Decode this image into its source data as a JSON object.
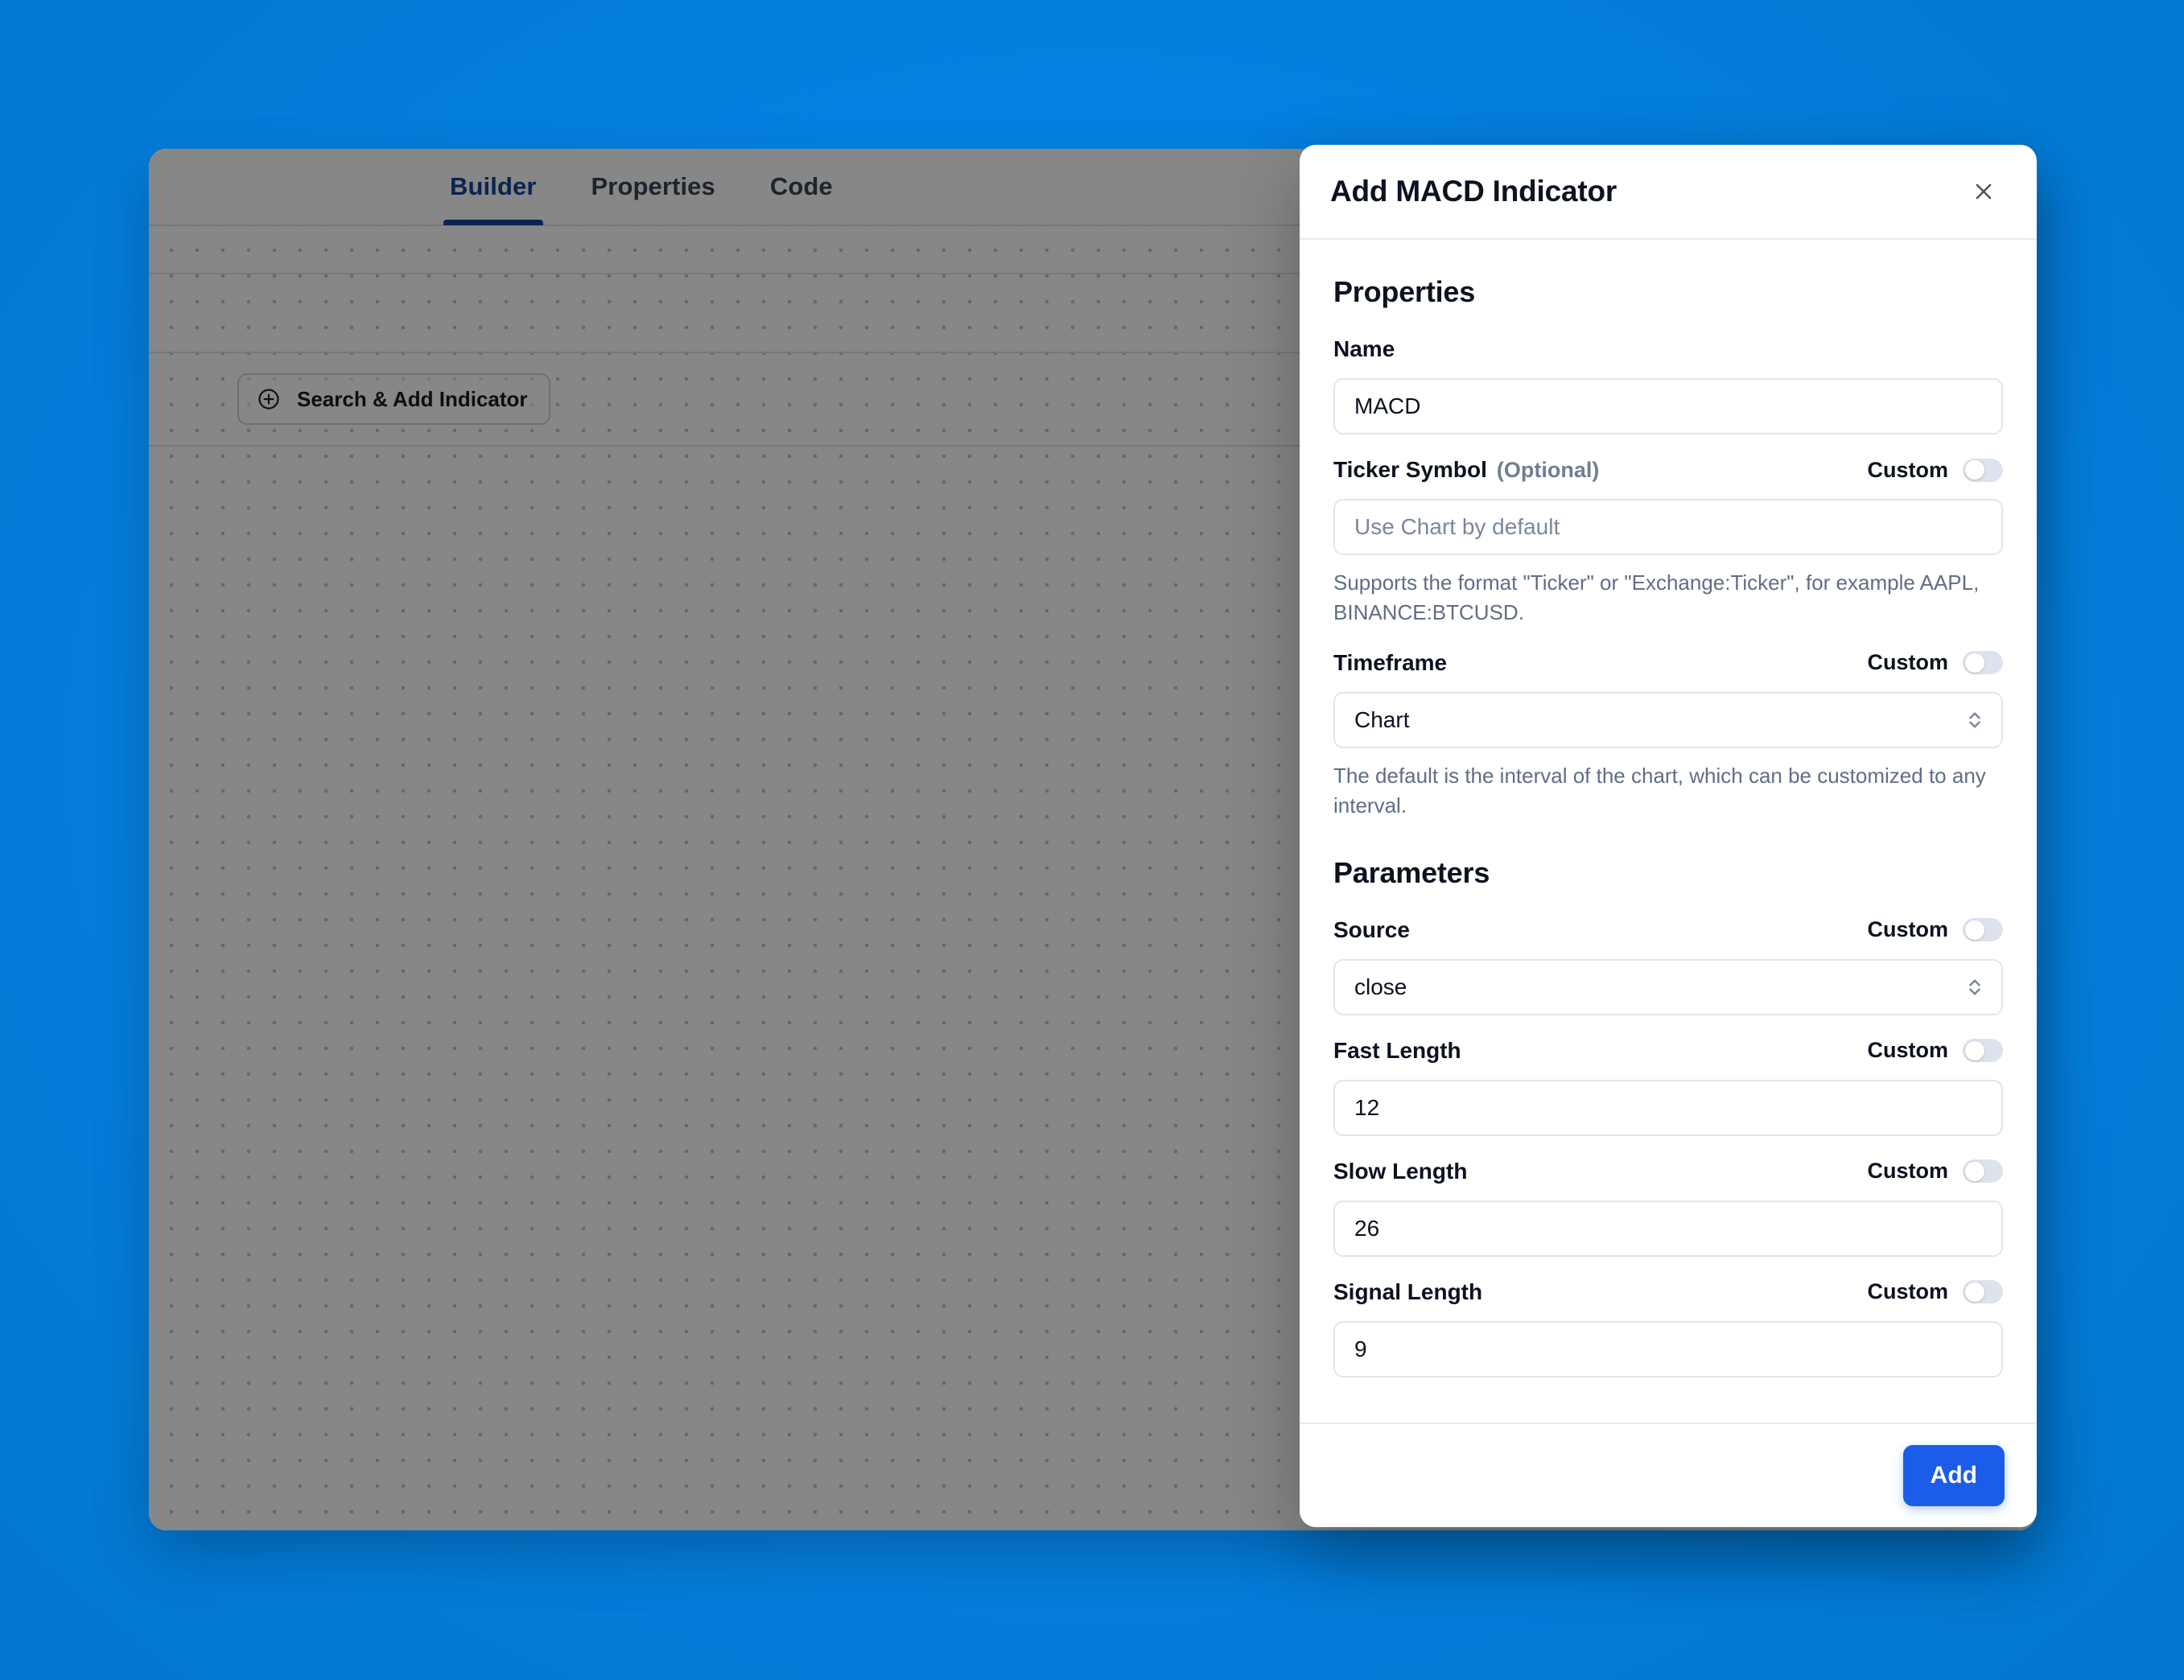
{
  "background": {
    "color": "#0581e2"
  },
  "app": {
    "tabs": [
      {
        "label": "Builder",
        "active": true
      },
      {
        "label": "Properties",
        "active": false
      },
      {
        "label": "Code",
        "active": false
      }
    ],
    "toolbar": {
      "add_icon": "plus-icon",
      "edit_icon": "pencil-icon"
    },
    "search_add_label": "Search & Add Indicator"
  },
  "modal": {
    "title": "Add MACD Indicator",
    "close_icon": "close-icon",
    "sections": {
      "properties_title": "Properties",
      "parameters_title": "Parameters"
    },
    "custom_label": "Custom",
    "fields": {
      "name": {
        "label": "Name",
        "value": "MACD"
      },
      "ticker_symbol": {
        "label": "Ticker Symbol",
        "optional": "(Optional)",
        "custom_label": "Custom",
        "custom_on": false,
        "placeholder": "Use Chart by default",
        "value": "",
        "hint": "Supports the format \"Ticker\" or \"Exchange:Ticker\", for example AAPL, BINANCE:BTCUSD."
      },
      "timeframe": {
        "label": "Timeframe",
        "custom_label": "Custom",
        "custom_on": false,
        "value": "Chart",
        "hint": "The default is the interval of the chart, which can be customized to any interval."
      },
      "source": {
        "label": "Source",
        "custom_label": "Custom",
        "custom_on": false,
        "value": "close"
      },
      "fast_length": {
        "label": "Fast Length",
        "custom_label": "Custom",
        "custom_on": false,
        "value": "12"
      },
      "slow_length": {
        "label": "Slow Length",
        "custom_label": "Custom",
        "custom_on": false,
        "value": "26"
      },
      "signal_length": {
        "label": "Signal Length",
        "custom_label": "Custom",
        "custom_on": false,
        "value": "9"
      }
    },
    "footer": {
      "add_label": "Add",
      "add_color": "#1b5de9"
    }
  }
}
